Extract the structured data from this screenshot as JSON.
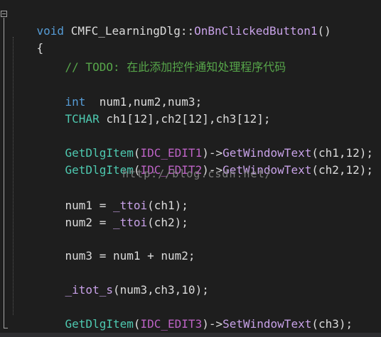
{
  "code": {
    "signature": {
      "kw_void": "void",
      "class_name": " CMFC_LearningDlg",
      "scope": "::",
      "method": "OnBnClickedButton1",
      "params": "()"
    },
    "open_brace": "{",
    "comment": "// TODO: 在此添加控件通知处理程序代码",
    "decl_int": {
      "kw": "int",
      "rest": "  num1,num2,num3;"
    },
    "decl_tchar": {
      "kw": "TCHAR",
      "rest": " ch1[12],ch2[12],ch3[12];"
    },
    "get1": {
      "fn": "GetDlgItem",
      "open": "(",
      "macro": "IDC_EDIT1",
      "arrow": ")->",
      "method": "GetWindowText",
      "args": "(ch1,12);"
    },
    "get2": {
      "fn": "GetDlgItem",
      "open": "(",
      "macro": "IDC_EDIT2",
      "arrow": ")->",
      "method": "GetWindowText",
      "args": "(ch2,12);"
    },
    "assign1": {
      "lhs": "num1 = ",
      "fn": "_ttoi",
      "args": "(ch1);"
    },
    "assign2": {
      "lhs": "num2 = ",
      "fn": "_ttoi",
      "args": "(ch2);"
    },
    "sum": "num3 = num1 + num2;",
    "itot": {
      "fn": "_itot_s",
      "args": "(num3,ch3,10);"
    },
    "set3": {
      "fn": "GetDlgItem",
      "open": "(",
      "macro": "IDC_EDIT3",
      "arrow": ")->",
      "method": "SetWindowText",
      "args": "(ch3);"
    },
    "close_brace": "}"
  },
  "watermark": "http://blog.csdn.net/",
  "colors": {
    "background": "#1e1e1e",
    "keyword": "#569cd6",
    "function": "#4ec9b0",
    "comment": "#57a64a",
    "macro": "#bd63c5",
    "text": "#dcdcdc"
  }
}
